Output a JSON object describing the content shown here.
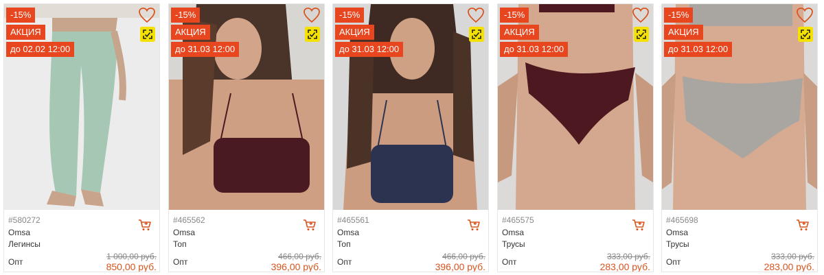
{
  "colors": {
    "accent": "#e8461e",
    "price": "#d9541e",
    "qr_badge": "#f5e100",
    "heart": "#d9541e"
  },
  "products": [
    {
      "discount": "-15%",
      "promo": "АКЦИЯ",
      "deadline": "до 02.02 12:00",
      "sku": "#580272",
      "brand": "Omsa",
      "type": "Легинсы",
      "opt": "Опт",
      "old_price": "1 000,00 руб.",
      "new_price": "850,00 руб.",
      "image": "leggings-mint-green",
      "image_color": "#a6c7b4"
    },
    {
      "discount": "-15%",
      "promo": "АКЦИЯ",
      "deadline": "до 31.03 12:00",
      "sku": "#465562",
      "brand": "Omsa",
      "type": "Топ",
      "opt": "Опт",
      "old_price": "466,00 руб.",
      "new_price": "396,00 руб.",
      "image": "top-burgundy",
      "image_color": "#4a1a22"
    },
    {
      "discount": "-15%",
      "promo": "АКЦИЯ",
      "deadline": "до 31.03 12:00",
      "sku": "#465561",
      "brand": "Omsa",
      "type": "Топ",
      "opt": "Опт",
      "old_price": "466,00 руб.",
      "new_price": "396,00 руб.",
      "image": "top-navy",
      "image_color": "#2b3350"
    },
    {
      "discount": "-15%",
      "promo": "АКЦИЯ",
      "deadline": "до 31.03 12:00",
      "sku": "#465575",
      "brand": "Omsa",
      "type": "Трусы",
      "opt": "Опт",
      "old_price": "333,00 руб.",
      "new_price": "283,00 руб.",
      "image": "briefs-burgundy",
      "image_color": "#4e1820"
    },
    {
      "discount": "-15%",
      "promo": "АКЦИЯ",
      "deadline": "до 31.03 12:00",
      "sku": "#465698",
      "brand": "Omsa",
      "type": "Трусы",
      "opt": "Опт",
      "old_price": "333,00 руб.",
      "new_price": "283,00 руб.",
      "image": "briefs-grey",
      "image_color": "#a9a5a0"
    }
  ]
}
